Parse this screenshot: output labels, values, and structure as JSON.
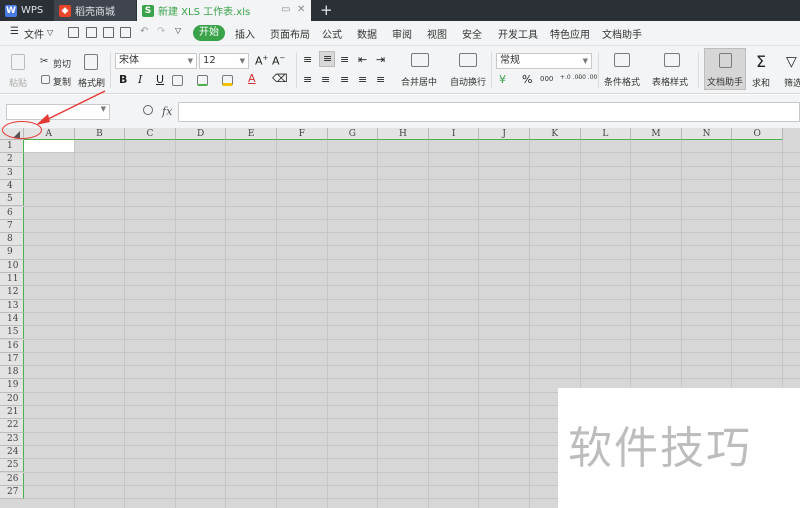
{
  "tabs": [
    {
      "label": "WPS",
      "icon": "wps-icon"
    },
    {
      "label": "稻壳商城",
      "icon": "docer-shop-icon"
    },
    {
      "label": "新建 XLS 工作表.xls",
      "icon": "spreadsheet-icon"
    }
  ],
  "menu": {
    "file": "文件",
    "start": "开始",
    "items": [
      "插入",
      "页面布局",
      "公式",
      "数据",
      "审阅",
      "视图",
      "安全",
      "开发工具",
      "特色应用",
      "文档助手"
    ]
  },
  "ribbon": {
    "paste": "粘贴",
    "cut": "剪切",
    "copy": "复制",
    "format_painter": "格式刷",
    "font_name": "宋体",
    "font_size": "12",
    "merge_center": "合并居中",
    "wrap_text": "自动换行",
    "number_format": "常规",
    "conditional_format": "条件格式",
    "table_style": "表格样式",
    "doc_assistant": "文档助手",
    "sum": "求和",
    "filter": "筛选",
    "bold": "B",
    "italic": "I",
    "underline": "U",
    "percent": "%",
    "thousands": "000",
    "dec_inc": "+.0 .00",
    "dec_dec": "-.0 .00"
  },
  "formula_bar": {
    "fx": "fx"
  },
  "grid": {
    "columns": [
      "A",
      "B",
      "C",
      "D",
      "E",
      "F",
      "G",
      "H",
      "I",
      "J",
      "K",
      "L",
      "M",
      "N",
      "O"
    ],
    "rows": [
      "1",
      "2",
      "3",
      "4",
      "5",
      "6",
      "7",
      "8",
      "9",
      "10",
      "11",
      "12",
      "13",
      "14",
      "15",
      "16",
      "17",
      "18",
      "19",
      "20",
      "21",
      "22",
      "23",
      "24",
      "25",
      "26",
      "27"
    ]
  },
  "watermark": "软件技巧",
  "colors": {
    "accent": "#3aa349",
    "annotation": "#e53935"
  }
}
